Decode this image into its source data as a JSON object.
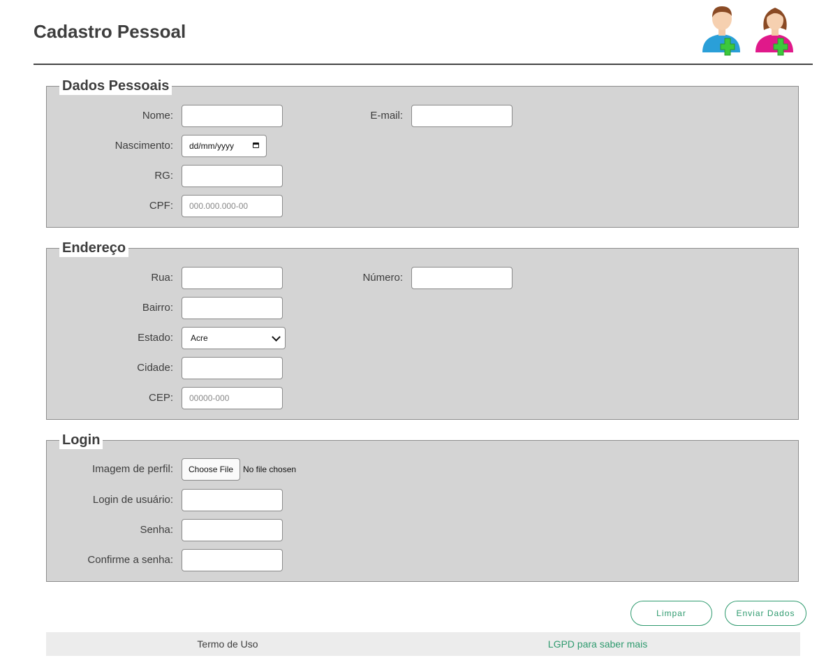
{
  "header": {
    "title": "Cadastro Pessoal",
    "icons": [
      "add-male-user-icon",
      "add-female-user-icon"
    ]
  },
  "dados_pessoais": {
    "legend": "Dados Pessoais",
    "nome_label": "Nome:",
    "email_label": "E-mail:",
    "nascimento_label": "Nascimento:",
    "nascimento_value": "dd/mm/yyyy",
    "rg_label": "RG:",
    "cpf_label": "CPF:",
    "cpf_placeholder": "000.000.000-00"
  },
  "endereco": {
    "legend": "Endereço",
    "rua_label": "Rua:",
    "numero_label": "Número:",
    "bairro_label": "Bairro:",
    "estado_label": "Estado:",
    "estado_value": "Acre",
    "cidade_label": "Cidade:",
    "cep_label": "CEP:",
    "cep_placeholder": "00000-000"
  },
  "login": {
    "legend": "Login",
    "imagem_label": "Imagem de perfil:",
    "file_button": "Choose File",
    "file_status": "No file chosen",
    "usuario_label": "Login de usuário:",
    "senha_label": "Senha:",
    "confirme_label": "Confirme a senha:"
  },
  "actions": {
    "limpar": "Limpar",
    "enviar": "Enviar Dados"
  },
  "footer": {
    "termo": "Termo de Uso",
    "lgpd": "LGPD para saber mais"
  },
  "colors": {
    "accent": "#2e9a6e",
    "section_bg": "#d4d4d4",
    "footer_bg": "#ececec",
    "male_icon": "#2a9fd8",
    "female_icon": "#e0198a",
    "plus_icon": "#3cc83c"
  }
}
